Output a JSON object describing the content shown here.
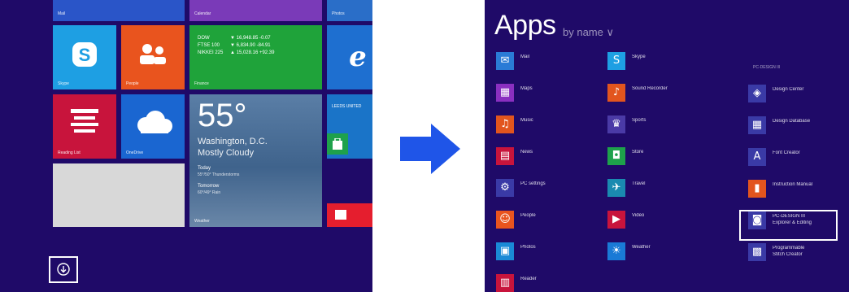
{
  "start": {
    "top_labels": [
      "Mail",
      "Calendar",
      "Photos"
    ],
    "tiles": [
      {
        "label": "Skype",
        "icon": "skype-icon",
        "color": "#1e9fe3"
      },
      {
        "label": "People",
        "icon": "people-icon",
        "color": "#e9541e"
      },
      {
        "label": "Finance",
        "icon": "finance-icon",
        "color": "#1fa33a",
        "rows": [
          [
            "DOW",
            "▼ 16,948.85 -0.07"
          ],
          [
            "FTSE 100",
            "▼ 6,834.90 -84.91"
          ],
          [
            "NIKKEI 225",
            "▲ 15,028.16 +92.39"
          ]
        ]
      },
      {
        "label": "",
        "icon": "ie-icon",
        "color": "#1e6fd0"
      },
      {
        "label": "Reading List",
        "icon": "reading-list-icon",
        "color": "#c8143c"
      },
      {
        "label": "OneDrive",
        "icon": "cloud-icon",
        "color": "#1a66d1"
      },
      {
        "label": "",
        "icon": "",
        "color": "#d8d8d8"
      },
      {
        "label": "Weather",
        "icon": "",
        "color": "#4a6f98",
        "temp": "55°",
        "city": "Washington, D.C.",
        "condition": "Mostly Cloudy",
        "today_label": "Today",
        "today_value": "55°/50° Thunderstorms",
        "tomorrow_label": "Tomorrow",
        "tomorrow_value": "60°/49° Rain"
      },
      {
        "label": "",
        "icon": "",
        "color": "#1a74c8",
        "text": "LEEDS UNITED"
      },
      {
        "label": "",
        "icon": "store-icon",
        "color": "#1ea14b"
      },
      {
        "label": "",
        "icon": "",
        "color": "#e51e2e"
      }
    ],
    "down_arrow_icon": "down-arrow-circle-icon"
  },
  "arrow": {
    "icon": "right-arrow-icon",
    "color": "#1f55e8"
  },
  "apps": {
    "title": "Apps",
    "sort_label": "by name ∨",
    "group_heading": "PC-DESIGN III",
    "col1": [
      {
        "name": "Mail",
        "icon": "✉",
        "color": "#2a7bd6"
      },
      {
        "name": "Maps",
        "icon": "▦",
        "color": "#8a2fc0"
      },
      {
        "name": "Music",
        "icon": "♫",
        "color": "#e2551e"
      },
      {
        "name": "News",
        "icon": "▤",
        "color": "#c8143c"
      },
      {
        "name": "PC settings",
        "icon": "⚙",
        "color": "#3a3aa6"
      },
      {
        "name": "People",
        "icon": "☺",
        "color": "#e9541e"
      },
      {
        "name": "Photos",
        "icon": "▣",
        "color": "#1a8ad6"
      },
      {
        "name": "Reader",
        "icon": "▥",
        "color": "#c8143c"
      }
    ],
    "col2": [
      {
        "name": "Skype",
        "icon": "S",
        "color": "#1e9fe3"
      },
      {
        "name": "Sound Recorder",
        "icon": "♪",
        "color": "#e2551e"
      },
      {
        "name": "Sports",
        "icon": "♛",
        "color": "#4a3aa6"
      },
      {
        "name": "Store",
        "icon": "◘",
        "color": "#1ea14b"
      },
      {
        "name": "Travel",
        "icon": "✈",
        "color": "#1a8ab0"
      },
      {
        "name": "Video",
        "icon": "▶",
        "color": "#c8143c"
      },
      {
        "name": "Weather",
        "icon": "☀",
        "color": "#1a7ad6"
      }
    ],
    "col3": [
      {
        "name": "Design Center",
        "name2": "",
        "icon": "◈",
        "color": "#3a3aa6"
      },
      {
        "name": "Design Database",
        "name2": "",
        "icon": "▦",
        "color": "#3a3aa6"
      },
      {
        "name": "Font Creator",
        "name2": "",
        "icon": "A",
        "color": "#3a3aa6"
      },
      {
        "name": "Instruction Manual",
        "name2": "",
        "icon": "▮",
        "color": "#e2551e"
      },
      {
        "name": "PC-DESIGN III",
        "name2": "Explorer & Editing",
        "icon": "◙",
        "color": "#3a3aa6"
      },
      {
        "name": "Programmable",
        "name2": "Stitch Creator",
        "icon": "▩",
        "color": "#3a3aa6"
      }
    ]
  }
}
